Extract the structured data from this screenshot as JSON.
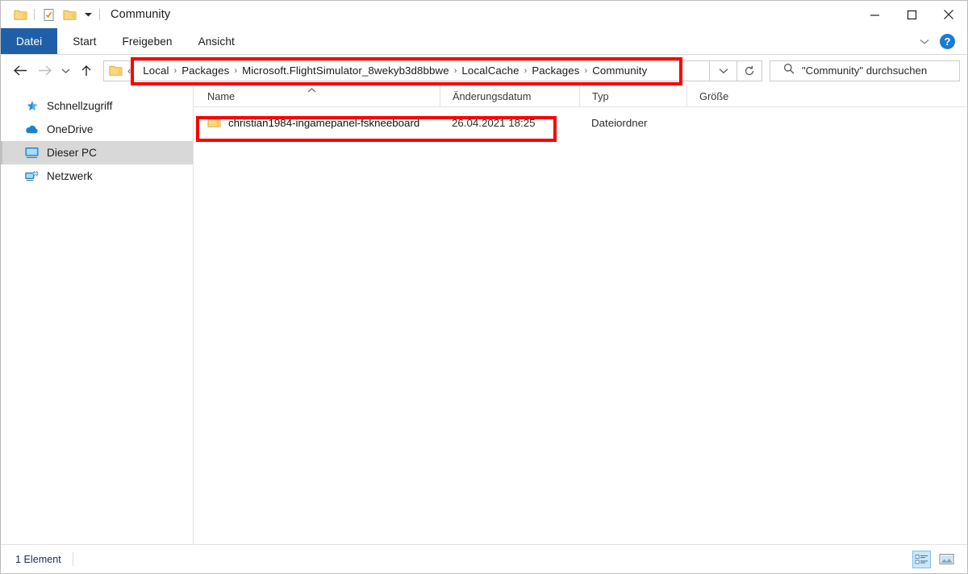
{
  "window": {
    "title": "Community",
    "quick_access": [
      {
        "name": "folder-icon",
        "label": "Ordner"
      },
      {
        "name": "properties-icon",
        "label": "Eigenschaften"
      },
      {
        "name": "new-folder-icon",
        "label": "Neuer Ordner"
      },
      {
        "name": "chevron-down-icon",
        "label": "Schnellzugriffsleiste anpassen"
      }
    ],
    "controls": {
      "minimize": "minimize-icon",
      "maximize": "maximize-icon",
      "close": "close-icon"
    }
  },
  "ribbon": {
    "tabs": [
      {
        "label": "Datei",
        "active": true
      },
      {
        "label": "Start",
        "active": false
      },
      {
        "label": "Freigeben",
        "active": false
      },
      {
        "label": "Ansicht",
        "active": false
      }
    ],
    "collapse_icon": "chevron-down-icon",
    "help_label": "?",
    "accent_color": "#1f5fa7"
  },
  "navigation": {
    "back_label": "Zurück",
    "forward_label": "Vorwärts",
    "history_label": "Zuletzt besuchte Orte",
    "up_label": "Eine Ebene nach oben",
    "overflow": "«",
    "dropdown_label": "Vorherige Orte",
    "refresh_label": "Aktualisieren"
  },
  "address": {
    "crumbs": [
      "Local",
      "Packages",
      "Microsoft.FlightSimulator_8wekyb3d8bbwe",
      "LocalCache",
      "Packages",
      "Community"
    ],
    "separator": "›"
  },
  "search": {
    "placeholder": "\"Community\" durchsuchen",
    "icon": "search-icon"
  },
  "sidebar": {
    "items": [
      {
        "label": "Schnellzugriff",
        "icon": "pin-star-icon",
        "selected": false
      },
      {
        "label": "OneDrive",
        "icon": "cloud-icon",
        "selected": false
      },
      {
        "label": "Dieser PC",
        "icon": "monitor-icon",
        "selected": true
      },
      {
        "label": "Netzwerk",
        "icon": "network-icon",
        "selected": false
      }
    ]
  },
  "filelist": {
    "columns": [
      "Name",
      "Änderungsdatum",
      "Typ",
      "Größe"
    ],
    "sort_column": "Name",
    "sort_direction": "ascending",
    "rows": [
      {
        "icon": "folder-icon",
        "name": "christian1984-ingamepanel-fskneeboard",
        "date": "26.04.2021 18:25",
        "type": "Dateiordner",
        "size": ""
      }
    ]
  },
  "statusbar": {
    "count_text": "1 Element",
    "views": [
      {
        "name": "details-view-button",
        "active": true
      },
      {
        "name": "large-icons-view-button",
        "active": false
      }
    ]
  },
  "annotations": {
    "color": "#fc0000",
    "boxes": [
      {
        "name": "address-bar-highlight",
        "target": "breadcrumb-path"
      },
      {
        "name": "folder-row-highlight",
        "target": "file-row-fskneeboard"
      }
    ]
  }
}
